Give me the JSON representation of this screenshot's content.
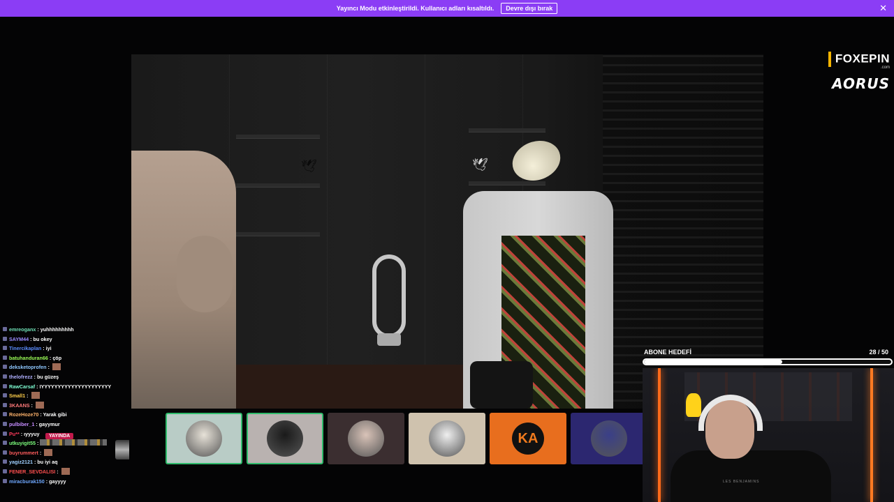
{
  "banner": {
    "message": "Yayıncı Modu etkinleştirildi. Kullanıcı adları kısaltıldı.",
    "disable_label": "Devre dışı bırak",
    "close_icon": "close-icon",
    "color": "#8b3df5"
  },
  "sponsors": {
    "foxepin": "FOXEPIN",
    "foxepin_domain": ".com",
    "aorus": "AORUS"
  },
  "chat": {
    "live_tag": "YAYINDA",
    "messages": [
      {
        "user": "emreoganx",
        "text": "yuhhhhhhhhh",
        "color": "#6fe0b6"
      },
      {
        "user": "SAYM44",
        "text": "bu okey",
        "color": "#9b8cff"
      },
      {
        "user": "Tinercikaplan",
        "text": "iyi",
        "color": "#5b8dff"
      },
      {
        "user": "batuhanduran66",
        "text": "çöp",
        "color": "#9cff57"
      },
      {
        "user": "deksketoprofen",
        "text": "",
        "color": "#8fc8ff",
        "emote": true
      },
      {
        "user": "thelofrezz",
        "text": "bu güzeş",
        "color": "#b0b0ff"
      },
      {
        "user": "RawCarsaf",
        "text": "IYYYYYYYYYYYYYYYYYYYYY",
        "color": "#7fffd4"
      },
      {
        "user": "Small1",
        "text": "",
        "color": "#ffcf4a",
        "emote": true
      },
      {
        "user": "3KAANS",
        "text": "",
        "color": "#ff7a7a",
        "emote": true
      },
      {
        "user": "RozeHoze70",
        "text": "Yarak gibi",
        "color": "#ffb36b"
      },
      {
        "user": "pulbiber_1",
        "text": "gayymur",
        "color": "#c58cff"
      },
      {
        "user": "Pu**",
        "text": "ıyyyuy",
        "color": "#ff3b5c"
      },
      {
        "user": "utkuyigit55",
        "text": "",
        "color": "#7dff7d",
        "emote_strip": true
      },
      {
        "user": "buyrummert",
        "text": "",
        "color": "#ff5c5c",
        "emote": true
      },
      {
        "user": "yagiz2121",
        "text": "bu iyi aq",
        "color": "#9fd0ff"
      },
      {
        "user": "FENER_SEVDALISI",
        "text": "",
        "color": "#ff4f4f",
        "emote": true
      },
      {
        "user": "miracburak150",
        "text": "gayyyy",
        "color": "#6fa8ff"
      }
    ]
  },
  "participants": [
    {
      "name": "participant-1",
      "bg": "#b9ccc6",
      "active": true,
      "avatar_color": "#e7e2d8"
    },
    {
      "name": "participant-2",
      "bg": "#b9b2b0",
      "active": true,
      "avatar_color": "#1a1a1a"
    },
    {
      "name": "participant-3",
      "bg": "#3b2e30",
      "active": false,
      "avatar_color": "#d9c3b8"
    },
    {
      "name": "participant-4",
      "bg": "#cfc2ae",
      "active": false,
      "avatar_color": "#efefef"
    },
    {
      "name": "participant-5",
      "bg": "#e86e1e",
      "active": false,
      "avatar_color": "#111111",
      "logo": "KA"
    },
    {
      "name": "participant-6",
      "bg": "#2c2770",
      "active": false,
      "avatar_color": "#3a3f88"
    }
  ],
  "sub_goal": {
    "label": "ABONE HEDEFİ",
    "current": 28,
    "target": 50,
    "count_text": "28 / 50"
  },
  "webcam": {
    "shirt_text": "LES BENJAMINS"
  }
}
